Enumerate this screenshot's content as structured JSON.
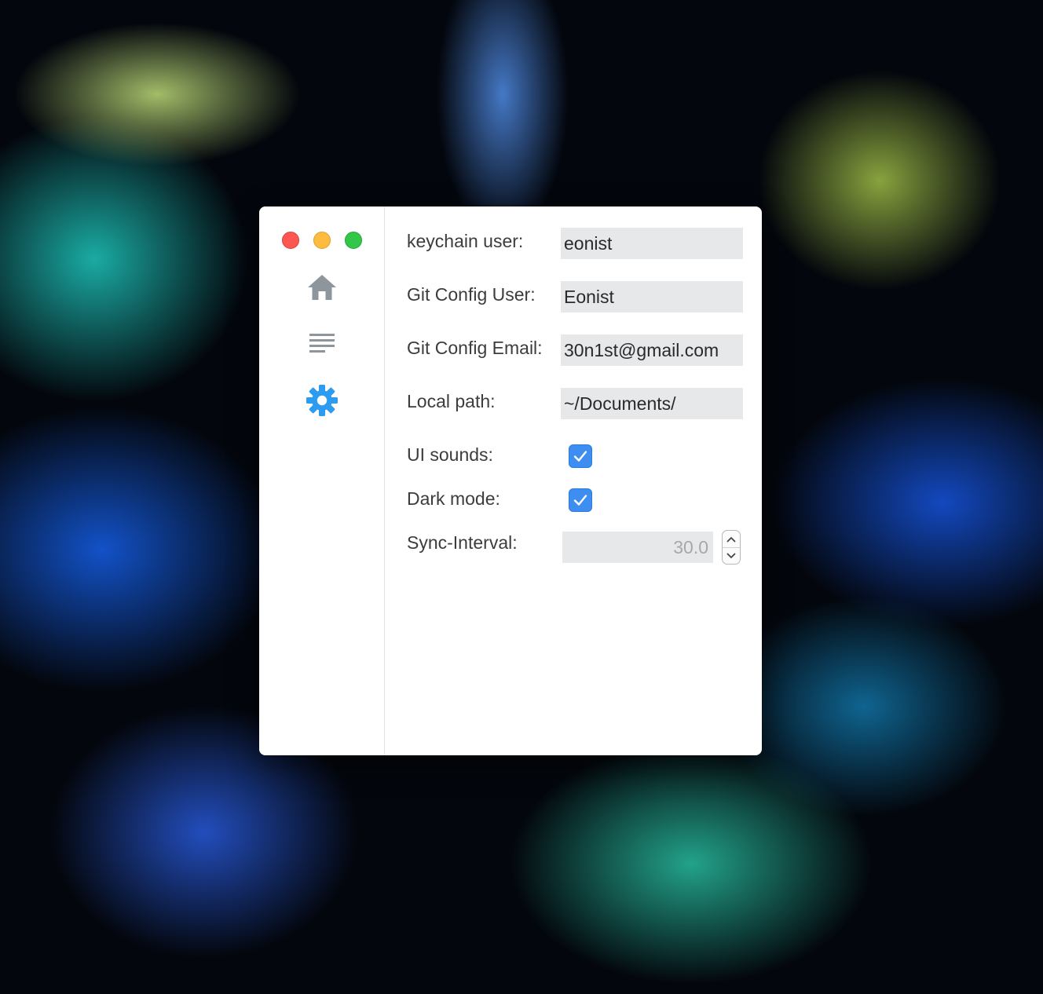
{
  "window": {
    "controls": {
      "close": "close",
      "minimize": "minimize",
      "zoom": "zoom"
    }
  },
  "sidebar": {
    "items": [
      {
        "id": "home",
        "icon": "home-icon",
        "color": "#8e969d"
      },
      {
        "id": "list",
        "icon": "list-icon",
        "color": "#8e969d"
      },
      {
        "id": "settings",
        "icon": "gear-icon",
        "color": "#2d9bf0",
        "active": true
      }
    ]
  },
  "preferences": {
    "keychain_user": {
      "label": "keychain user:",
      "value": "eonist"
    },
    "git_config_user": {
      "label": "Git Config User:",
      "value": "Eonist"
    },
    "git_config_email": {
      "label": "Git Config Email:",
      "value": "30n1st@gmail.com"
    },
    "local_path": {
      "label": "Local path:",
      "value": "~/Documents/"
    },
    "ui_sounds": {
      "label": "UI sounds:",
      "checked": true
    },
    "dark_mode": {
      "label": "Dark mode:",
      "checked": true
    },
    "sync_interval": {
      "label": "Sync-Interval:",
      "value": "30.0"
    }
  },
  "colors": {
    "checkbox_accent": "#3d8ef0",
    "active_icon": "#2d9bf0",
    "inactive_icon": "#8e969d",
    "field_background": "#e7e8ea"
  }
}
